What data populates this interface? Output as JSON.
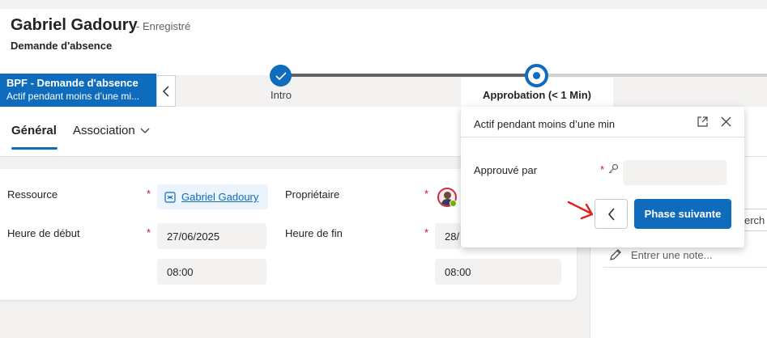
{
  "record": {
    "title": "Gabriel Gadoury",
    "status": "- Enregistré",
    "entity": "Demande d'absence"
  },
  "bpf": {
    "flyout_title": "BPF - Demande d'absence",
    "flyout_subtitle": "Actif pendant moins d’une mi...",
    "stages": [
      {
        "label": "Intro",
        "state": "completed"
      },
      {
        "label": "Approbation  (< 1 Min)",
        "state": "active"
      }
    ]
  },
  "tabs": [
    {
      "label": "Général",
      "selected": true
    },
    {
      "label": "Association",
      "selected": false
    }
  ],
  "form": {
    "ressource_label": "Ressource",
    "ressource_value": "Gabriel Gadoury",
    "proprietaire_label": "Propriétaire",
    "heure_debut_label": "Heure de début",
    "heure_debut_date": "27/06/2025",
    "heure_debut_time": "08:00",
    "heure_fin_label": "Heure de fin",
    "heure_fin_date": "28/",
    "heure_fin_time": "08:00",
    "required_mark": "*"
  },
  "side_panel": {
    "search_text": "erch",
    "note_placeholder": "Entrer une note..."
  },
  "stage_popup": {
    "title": "Actif pendant moins d’une min",
    "field_label": "Approuvé par",
    "required_mark": "*",
    "next_label": "Phase suivante"
  },
  "colors": {
    "brand": "#0f6cbd",
    "required": "#c50f1f",
    "annotation_arrow": "#e0201c",
    "presence": "#6bb700"
  }
}
